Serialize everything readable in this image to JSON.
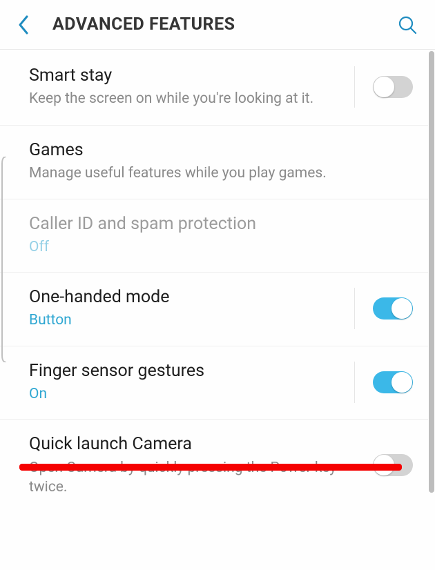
{
  "header": {
    "title": "ADVANCED FEATURES"
  },
  "items": [
    {
      "title": "Smart stay",
      "sub": "Keep the screen on while you're looking at it.",
      "toggle": "off"
    },
    {
      "title": "Games",
      "sub": "Manage useful features while you play games."
    },
    {
      "title": "Caller ID and spam protection",
      "sub": "Off",
      "disabled": true
    },
    {
      "title": "One-handed mode",
      "sub": "Button",
      "toggle": "on"
    },
    {
      "title": "Finger sensor gestures",
      "sub": "On",
      "toggle": "on"
    },
    {
      "title": "Quick launch Camera",
      "sub": "Open Camera by quickly pressing the Power key twice.",
      "toggle": "off"
    }
  ]
}
